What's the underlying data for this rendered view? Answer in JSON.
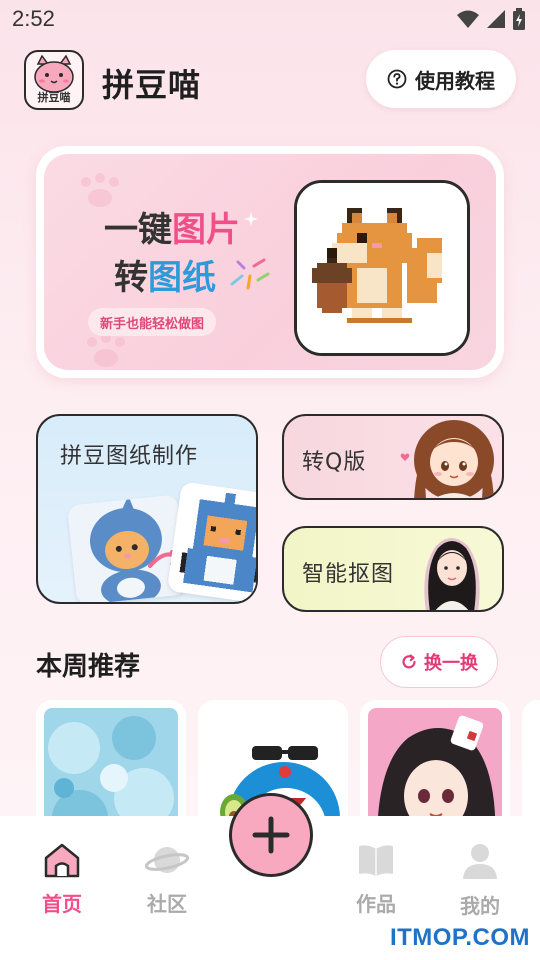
{
  "status_bar": {
    "time": "2:52"
  },
  "header": {
    "app_name": "拼豆喵",
    "logo_text": "拼豆喵",
    "tutorial_label": "使用教程"
  },
  "banner": {
    "line1_prefix": "一键",
    "line1_highlight": "图片",
    "line2_prefix": "转",
    "line2_highlight": "图纸",
    "subtitle": "新手也能轻松做图"
  },
  "features": {
    "beads": "拼豆图纸制作",
    "q_version": "转Q版",
    "cutout": "智能抠图"
  },
  "weekly": {
    "title": "本周推荐",
    "refresh_label": "换一换"
  },
  "nav": {
    "home": "首页",
    "community": "社区",
    "works": "作品",
    "mine": "我的"
  },
  "watermark": "ITMOP.COM",
  "colors": {
    "accent": "#f24f8a",
    "blue_highlight": "#2d9bd9",
    "fab": "#f8a9c0"
  }
}
